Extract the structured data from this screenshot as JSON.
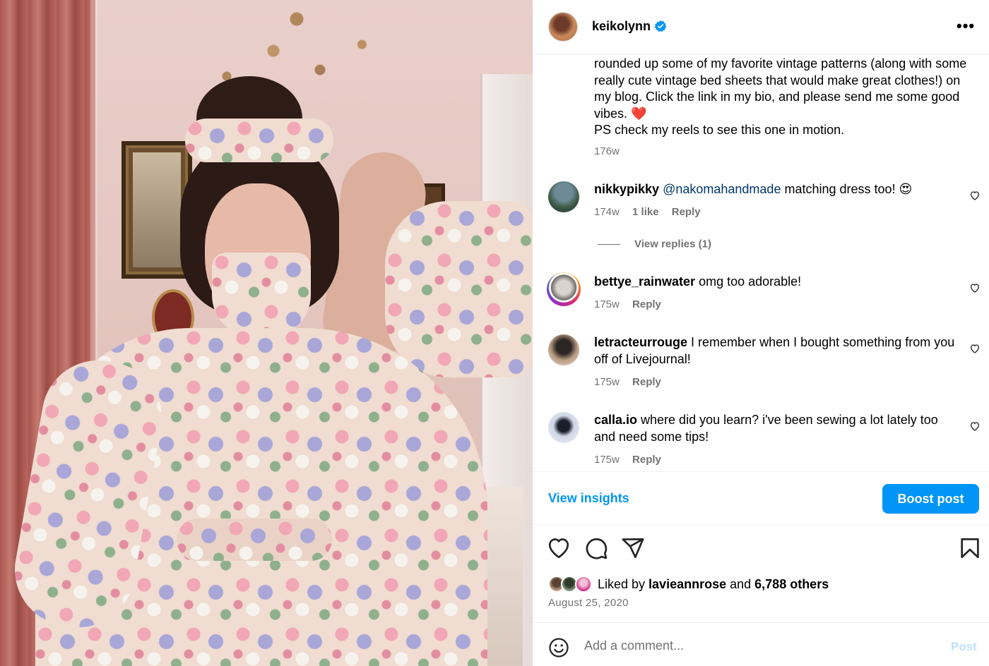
{
  "post": {
    "username": "keikolynn",
    "caption": "rounded up some of my favorite vintage patterns (along with some really cute vintage bed sheets that would make great clothes!) on my blog. Click the link in my bio, and please send me some good vibes. ❤️\nPS check my reels to see this one in motion.",
    "caption_time": "176w",
    "more_label": "•••"
  },
  "comments": [
    {
      "username": "nikkypikky",
      "mention": "@nakomahandmade",
      "text": " matching dress too! 😍",
      "time": "174w",
      "likes": "1 like",
      "reply": "Reply",
      "view_replies": "View replies (1)"
    },
    {
      "username": "bettye_rainwater",
      "text": " omg too adorable!",
      "time": "175w",
      "reply": "Reply"
    },
    {
      "username": "letracteurrouge",
      "text": " I remember when I bought something from you off of Livejournal!",
      "time": "175w",
      "reply": "Reply"
    },
    {
      "username": "calla.io",
      "text": " where did you learn? i've been sewing a lot lately too and need some tips!",
      "time": "175w",
      "reply": "Reply"
    }
  ],
  "insights": {
    "view_label": "View insights",
    "boost_label": "Boost post"
  },
  "likes": {
    "prefix": "Liked by ",
    "user": "lavieannrose",
    "middle": " and ",
    "others": "6,788 others"
  },
  "date": "August 25, 2020",
  "add_comment": {
    "placeholder": "Add a comment...",
    "post_label": "Post"
  },
  "colors": {
    "accent": "#0095f6",
    "verified": "#0095f6",
    "muted": "#737373",
    "mention": "#00376b"
  },
  "icons": [
    "verified-badge-icon",
    "more-options-icon",
    "heart-icon",
    "comment-icon",
    "share-icon",
    "save-icon",
    "emoji-icon"
  ]
}
